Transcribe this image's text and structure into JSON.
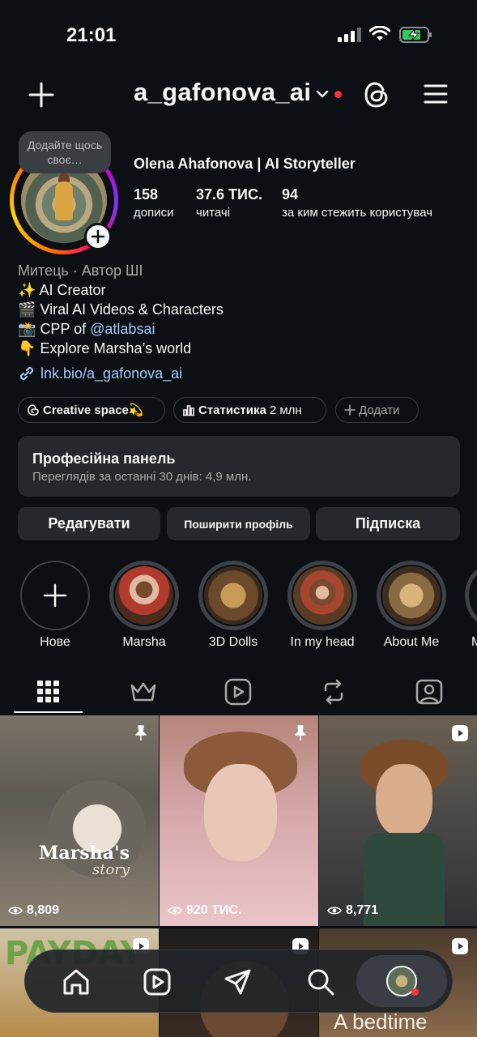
{
  "status_bar": {
    "time": "21:01"
  },
  "header": {
    "username": "a_gafonova_ai"
  },
  "profile": {
    "note": "Додайте щось своє…",
    "display_name": "Olena Ahafonova | AI Storyteller",
    "stats": [
      {
        "value": "158",
        "label": "дописи"
      },
      {
        "value": "37.6 ТИС.",
        "label": "читачі"
      },
      {
        "value": "94",
        "label": "за ким стежить користувач"
      }
    ],
    "category": "Митець · Автор ШІ",
    "bio_lines": [
      {
        "emoji": "✨",
        "text": "AI Creator"
      },
      {
        "emoji": "🎬",
        "text": "Viral AI Videos & Characters"
      },
      {
        "emoji": "📸",
        "text": "CPP of ",
        "mention": "@atlabsai"
      },
      {
        "emoji": "👇",
        "text": "Explore Marsha’s world"
      }
    ],
    "link": "lnk.bio/a_gafonova_ai"
  },
  "chips": {
    "creative_space": "Creative space💫",
    "stats_label": "Статистика",
    "stats_value": "2 млн",
    "add_label": "Додати"
  },
  "pro_panel": {
    "title": "Професійна панель",
    "subtitle": "Переглядів за останні 30 днів: 4,9 млн."
  },
  "actions": {
    "edit": "Редагувати",
    "share": "Поширити профіль",
    "subscribe": "Підписка"
  },
  "highlights": [
    {
      "label": "Нове"
    },
    {
      "label": "Marsha"
    },
    {
      "label": "3D Dolls"
    },
    {
      "label": "In my head"
    },
    {
      "label": "About Me"
    },
    {
      "label": "M"
    }
  ],
  "posts": [
    {
      "views": "8,809",
      "overlay": "Marsha's",
      "overlay2": "story",
      "badge": "pin-icon"
    },
    {
      "views": "920 ТИС.",
      "badge": "pin-icon"
    },
    {
      "views": "8,771",
      "badge": "reel-icon"
    },
    {
      "overlay": "PAYDAY",
      "badge": "reel-icon"
    },
    {
      "badge": "reel-icon"
    },
    {
      "overlay": "A bedtime",
      "badge": "reel-icon"
    }
  ],
  "colors": {
    "background": "#0c1014",
    "surface": "#25292e",
    "link": "#a8c7fa",
    "notification": "#ff3040"
  }
}
